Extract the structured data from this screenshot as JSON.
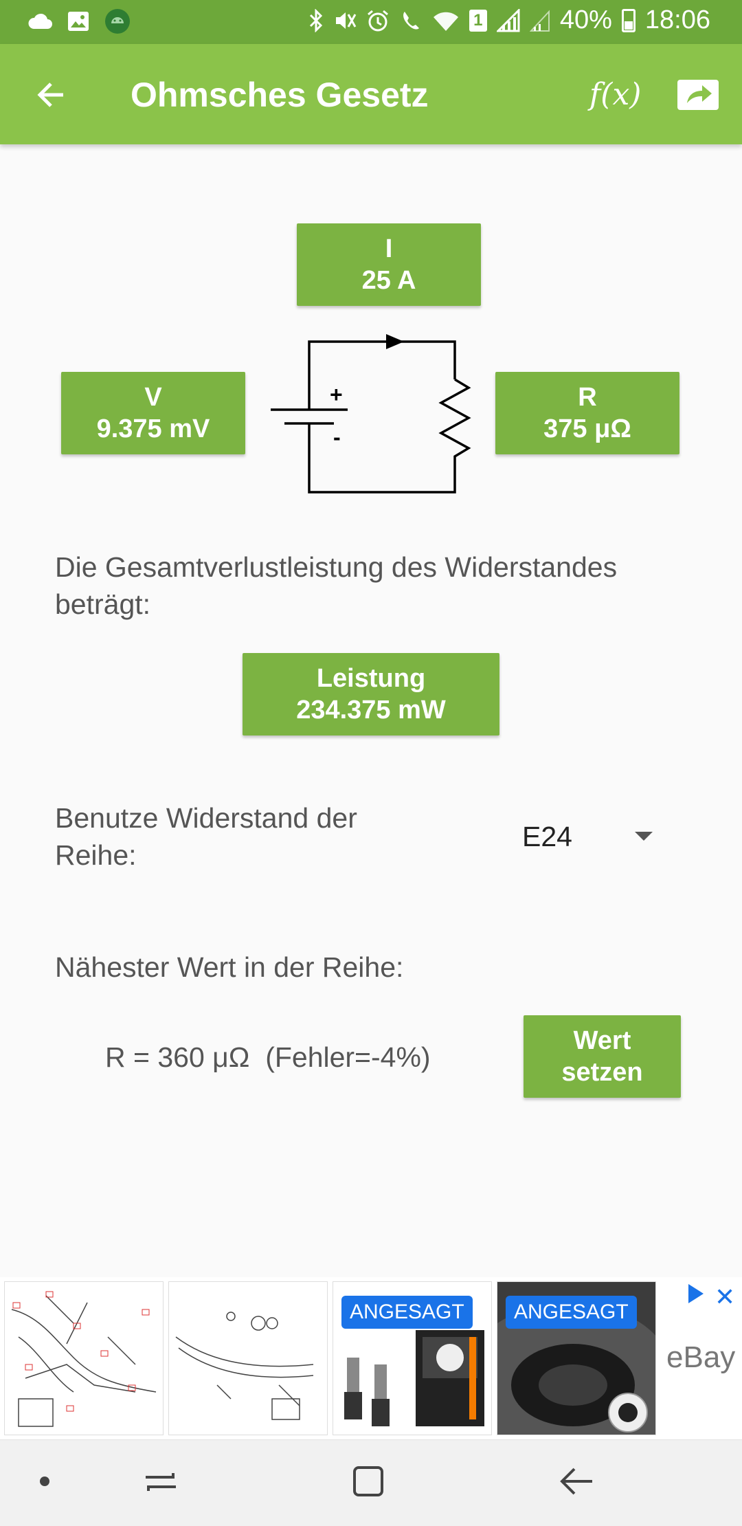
{
  "status_bar": {
    "battery": "40%",
    "time": "18:06",
    "sim_badge": "1"
  },
  "app_bar": {
    "title": "Ohmsches Gesetz",
    "fx_label": "f(x)"
  },
  "circuit": {
    "current": {
      "label": "I",
      "value": "25 A"
    },
    "voltage": {
      "label": "V",
      "value": "9.375 mV"
    },
    "resistance": {
      "label": "R",
      "value": "375 μΩ"
    },
    "plus_sign": "+",
    "minus_sign": "-"
  },
  "power": {
    "description": "Die Gesamtverlustleistung des Widerstandes beträgt:",
    "label": "Leistung",
    "value": "234.375 mW"
  },
  "series": {
    "label": "Benutze Widerstand der Reihe:",
    "selected": "E24"
  },
  "nearest": {
    "label": "Nähester Wert in der Reihe:",
    "result": "R = 360 μΩ  (Fehler=-4%)",
    "button_line1": "Wert",
    "button_line2": "setzen"
  },
  "ad": {
    "badge": "ANGESAGT",
    "brand": "eBay"
  },
  "colors": {
    "status_bar": "#6da83a",
    "app_bar": "#8bc34a",
    "box": "#7cb342",
    "ad_accent": "#1a73e8"
  }
}
